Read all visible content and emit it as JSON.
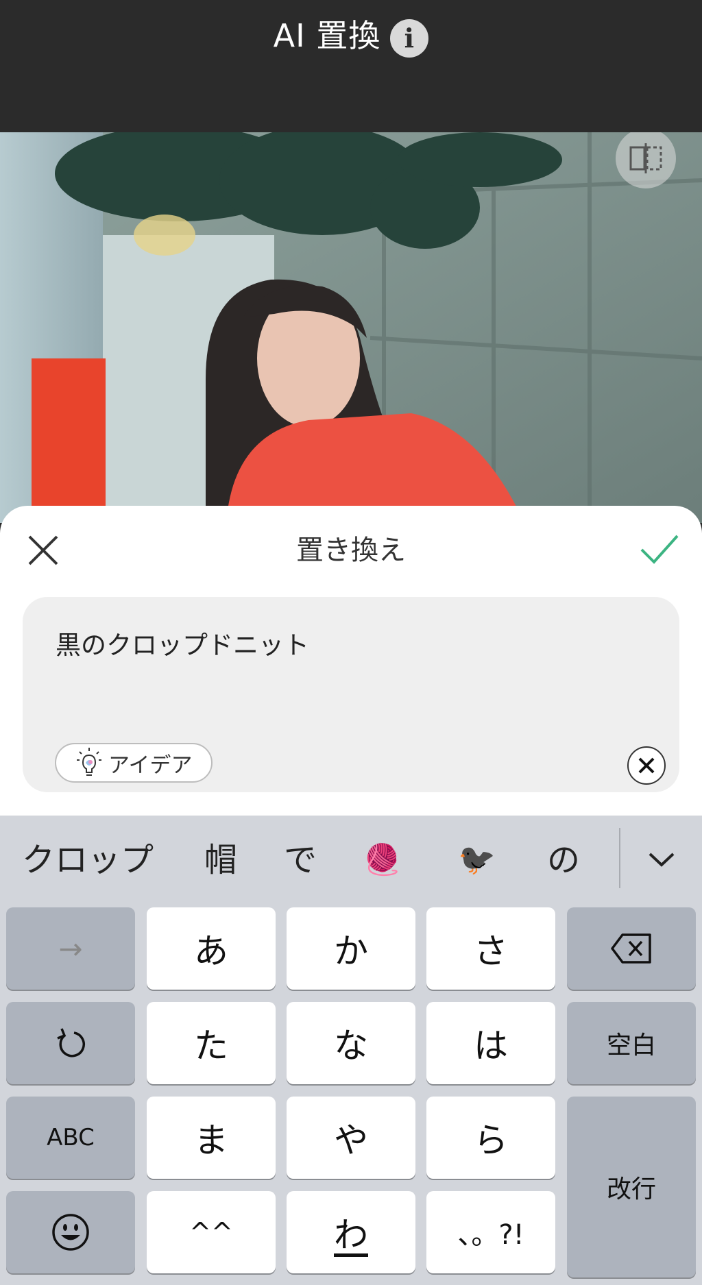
{
  "header": {
    "title": "AI 置換",
    "info_label": "i"
  },
  "sheet": {
    "title": "置き換え"
  },
  "prompt": {
    "value": "黒のクロップドニット",
    "idea_label": "アイデア"
  },
  "keyboard": {
    "suggestions": [
      "クロップ",
      "帽",
      "で",
      "🧶",
      "🐦‍⬛",
      "の"
    ],
    "rows": [
      [
        "→",
        "あ",
        "か",
        "さ",
        "⌫"
      ],
      [
        "↺",
        "た",
        "な",
        "は",
        "空白"
      ],
      [
        "ABC",
        "ま",
        "や",
        "ら",
        "改行"
      ],
      [
        "☺",
        "^^",
        "わ",
        "、。?!"
      ]
    ]
  },
  "colors": {
    "topbar": "#2b2b2b",
    "accent_check": "#3cb482",
    "keyboard_bg": "#d2d5db",
    "key_dark": "#adb3bd"
  }
}
